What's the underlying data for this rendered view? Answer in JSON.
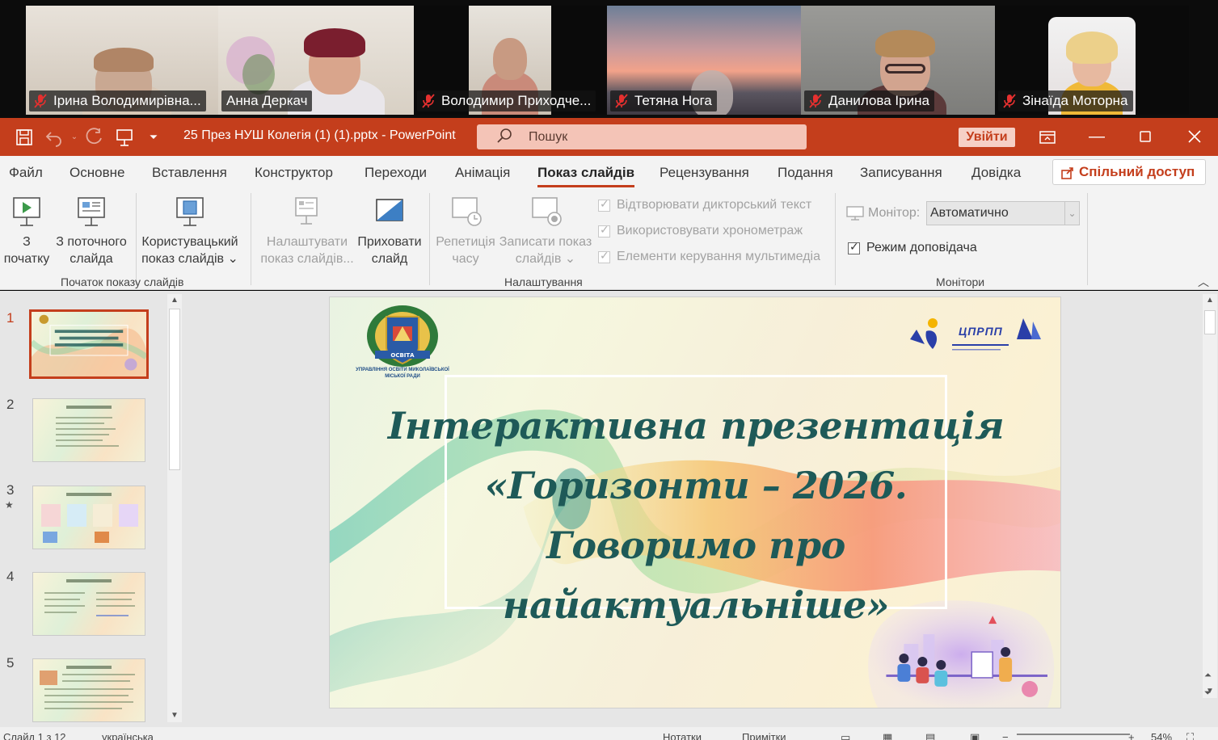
{
  "participants": [
    {
      "name": "Ірина Володимирівна...",
      "active": false
    },
    {
      "name": "Анна Деркач",
      "active": true
    },
    {
      "name": "Володимир Приходче...",
      "active": false
    },
    {
      "name": "Тетяна Нога",
      "active": false
    },
    {
      "name": "Данилова Ірина",
      "active": false
    },
    {
      "name": "Зінаїда Моторна",
      "active": false
    }
  ],
  "titlebar": {
    "document_title": "25 През НУШ Колегія (1) (1).pptx  -  PowerPoint",
    "search_placeholder": "Пошук",
    "signin_label": "Увійти",
    "accent_color": "#c43e1c"
  },
  "ribbon": {
    "tabs": [
      "Файл",
      "Основне",
      "Вставлення",
      "Конструктор",
      "Переходи",
      "Анімація",
      "Показ слайдів",
      "Рецензування",
      "Подання",
      "Записування",
      "Довідка"
    ],
    "active_tab": "Показ слайдів",
    "share_label": "Спільний доступ",
    "groups": {
      "start": {
        "label": "Початок показу слайдів",
        "buttons": [
          {
            "line1": "З",
            "line2": "початку"
          },
          {
            "line1": "З поточного",
            "line2": "слайда"
          },
          {
            "line1": "Користувацький",
            "line2": "показ слайдів ⌄"
          }
        ]
      },
      "setup": {
        "label": "Налаштування",
        "buttons": [
          {
            "line1": "Налаштувати",
            "line2": "показ слайдів..."
          },
          {
            "line1": "Приховати",
            "line2": "слайд"
          },
          {
            "line1": "Репетиція",
            "line2": "часу"
          },
          {
            "line1": "Записати показ",
            "line2": "слайдів ⌄"
          }
        ],
        "checkboxes": [
          "Відтворювати дикторський текст",
          "Використовувати хронометраж",
          "Елементи керування мультимедіа"
        ]
      },
      "monitors": {
        "label": "Монітори",
        "monitor_label": "Монітор:",
        "monitor_value": "Автоматично",
        "presenter_view": "Режим доповідача"
      }
    }
  },
  "thumbnails": [
    {
      "number": "1",
      "title": "Інтерактивна презентація «Горизонти – 2026. Говоримо про найактуальніше»",
      "active": true
    },
    {
      "number": "2",
      "title": "Нормативна база",
      "active": false
    },
    {
      "number": "3",
      "title": "Локальні документи",
      "active": false
    },
    {
      "number": "4",
      "title": "Інноваційні технології",
      "active": false
    },
    {
      "number": "5",
      "title": "Якість освіти 2025/2026 н.р.",
      "active": false
    }
  ],
  "slide": {
    "title_lines": [
      "Інтерактивна презентація",
      "«Горизонти – 2026.",
      "Говоримо про найактуальніше»"
    ],
    "emblem_caption": "УПРАВЛІННЯ ОСВІТИ МИКОЛАЇВСЬКОЇ МІСЬКОЇ РАДИ",
    "emblem_band": "ОСВІТА",
    "partner_logo_text": "ЦПРПП",
    "title_color": "#1e5a58"
  },
  "statusbar": {
    "slide_info": "Слайд 1 з 12",
    "language": "українська",
    "notes_label": "Нотатки",
    "comments_label": "Примітки",
    "zoom": "54%"
  }
}
